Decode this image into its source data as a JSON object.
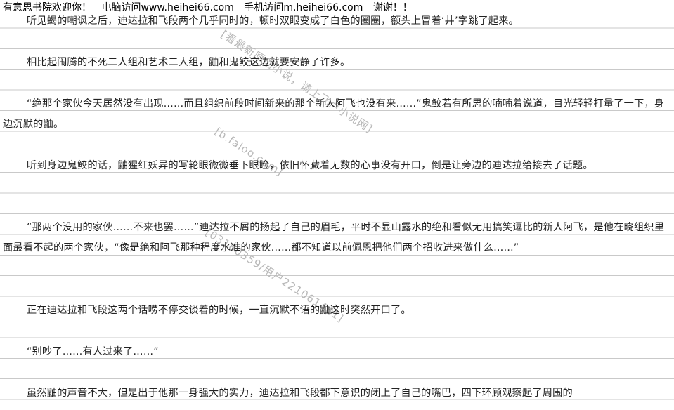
{
  "header": {
    "welcome": "有意思书院欢迎你！",
    "pc": "电脑访问www.heihei66.com",
    "mobile": "手机访问m.heihei66.com",
    "thanks": "谢谢！！"
  },
  "paragraphs": [
    "听见蝎的嘲讽之后，迪达拉和飞段两个几乎同时的，顿时双眼变成了白色的圈圈，额头上冒着‘井’字跳了起来。",
    "相比起闹腾的不死二人组和艺术二人组，鼬和鬼鲛这边就要安静了许多。",
    "“绝那个家伙今天居然没有出现……而且组织前段时间新来的那个新人阿飞也没有来……”鬼鲛若有所思的喃喃着说道，目光轻轻打量了一下，身边沉默的鼬。",
    "听到身边鬼鲛的话，鼬猩红妖异的写轮眼微微垂下眼睑，依旧怀藏着无数的心事没有开口，倒是让旁边的迪达拉给接去了话题。",
    "“那两个没用的家伙……不来也罢……”迪达拉不屑的扬起了自己的眉毛，平时不显山露水的绝和看似无用搞笑逗比的新人阿飞，是他在晓组织里面最看不起的两个家伙，“像是绝和阿飞那种程度水准的家伙……都不知道以前佩恩把他们两个招收进来做什么……”",
    "正在迪达拉和飞段这两个话唠不停交谈着的时候，一直沉默不语的鼬这时突然开口了。",
    "“别吵了……有人过来了……”",
    "虽然鼬的声音不大，但是出于他那一身强大的实力，迪达拉和飞段都下意识的闭上了自己的嘴巴，四下环顾观察起了周围的"
  ],
  "watermarks": [
    "[看最新原创小说，请上飞卢小说网]",
    "[b.faloo.com]",
    "[03160359/用户221061461]"
  ]
}
